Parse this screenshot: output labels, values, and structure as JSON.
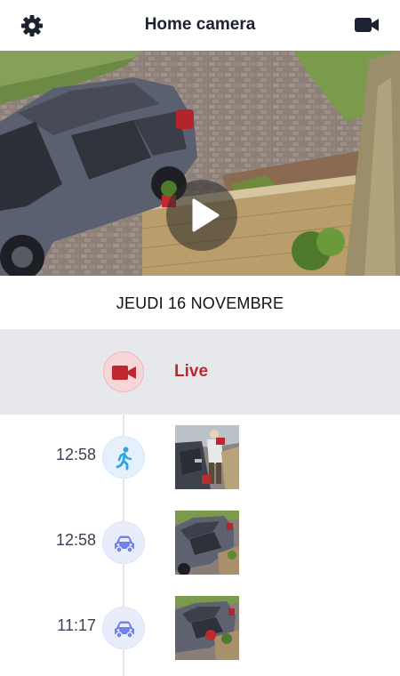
{
  "header": {
    "title": "Home camera",
    "left_icon": "settings-gear-icon",
    "right_icon": "video-camera-icon"
  },
  "video": {
    "play_icon": "play-icon"
  },
  "date_label": "JEUDI 16 NOVEMBRE",
  "live": {
    "label": "Live",
    "icon": "video-camera-icon",
    "color": "#c0262e"
  },
  "events": [
    {
      "time": "12:58",
      "type": "person",
      "icon": "person-walking-icon",
      "icon_color": "#2fa3e6"
    },
    {
      "time": "12:58",
      "type": "vehicle",
      "icon": "car-icon",
      "icon_color": "#6f83e6"
    },
    {
      "time": "11:17",
      "type": "vehicle",
      "icon": "car-icon",
      "icon_color": "#6f83e6"
    }
  ]
}
